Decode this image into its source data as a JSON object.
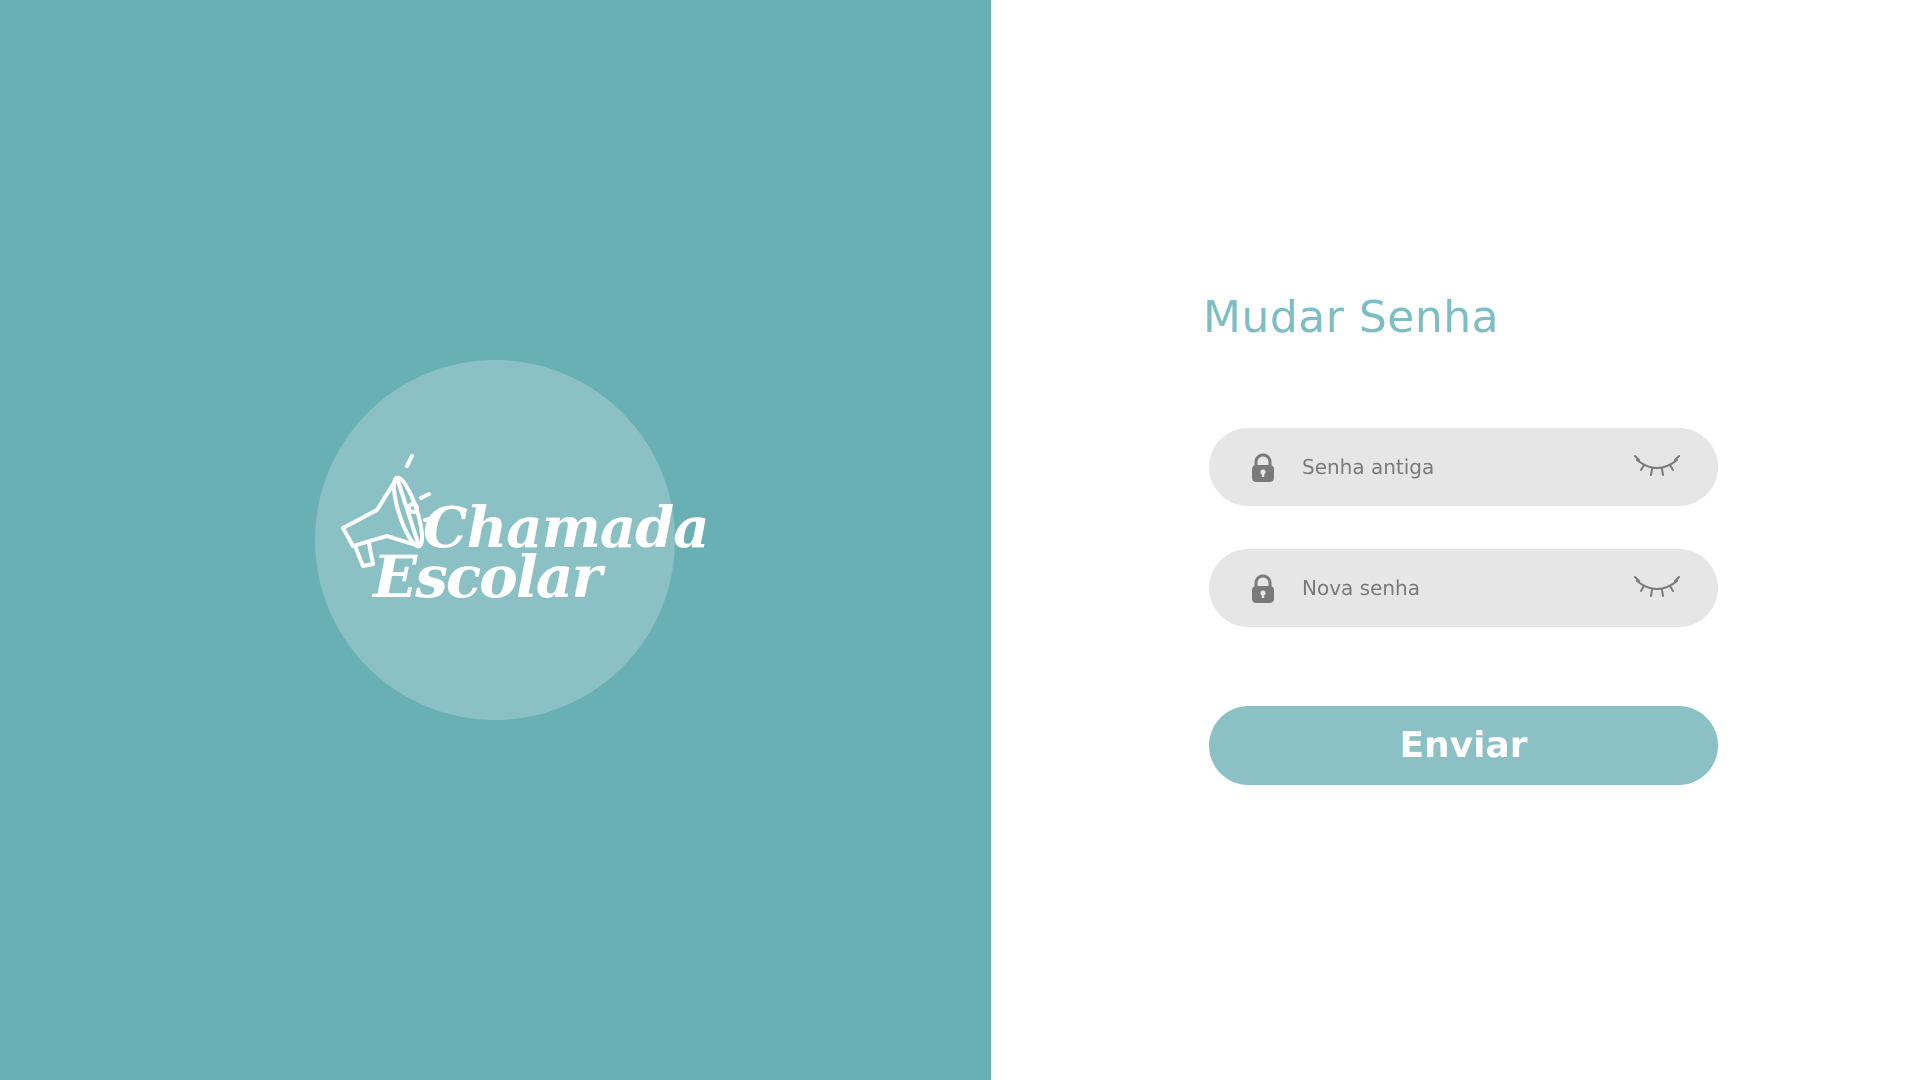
{
  "logo": {
    "line1": "Chamada",
    "line2": "Escolar",
    "icon": "megaphone-icon"
  },
  "form": {
    "title": "Mudar Senha",
    "old_password": {
      "placeholder": "Senha antiga",
      "value": "",
      "leading_icon": "lock-icon",
      "trailing_icon": "eye-closed-icon"
    },
    "new_password": {
      "placeholder": "Nova senha",
      "value": "",
      "leading_icon": "lock-icon",
      "trailing_icon": "eye-closed-icon"
    },
    "submit_label": "Enviar"
  },
  "colors": {
    "left_panel": "#68b0b4",
    "logo_circle": "#8bc1c4",
    "title": "#7dbec3",
    "field_background": "#e6e6e6",
    "button": "#8bc1c4",
    "icon_gray": "#7a7a7a"
  }
}
